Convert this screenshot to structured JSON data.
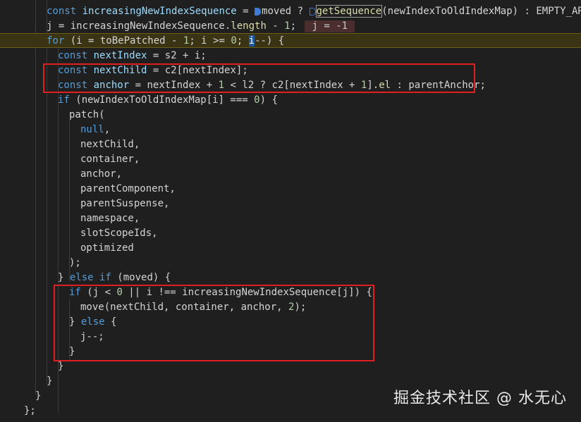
{
  "code": {
    "l01_a": "const",
    "l01_b": "increasingNewIndexSequence",
    "l01_c": " = ",
    "l01_d": "moved",
    "l01_e": " ? ",
    "l01_f": "getSequence",
    "l01_g": "(newIndexToOldIndexMap) : EMPTY_ARR;",
    "l02_a": "j = increasingNewIndexSequence.",
    "l02_b": "length",
    "l02_c": " - ",
    "l02_d": "1",
    "l02_e": ";",
    "l02_hint": "j = -1",
    "l03_a": "for",
    "l03_b": " (i = toBePatched - ",
    "l03_c": "1",
    "l03_d": "; i >= ",
    "l03_e": "0",
    "l03_f": "; ",
    "l03_g": "i",
    "l03_h": "--) {",
    "l04_a": "const",
    "l04_b": "nextIndex",
    "l04_c": " = s2 + i;",
    "l05_a": "const",
    "l05_b": "nextChild",
    "l05_c": " = c2[nextIndex];",
    "l06_a": "const",
    "l06_b": "anchor",
    "l06_c": " = nextIndex + ",
    "l06_d": "1",
    "l06_e": " < l2 ? c2[nextIndex + ",
    "l06_f": "1",
    "l06_g": "].",
    "l06_h": "el",
    "l06_i": " : parentAnchor;",
    "l07_a": "if",
    "l07_b": " (newIndexToOldIndexMap[i] === ",
    "l07_c": "0",
    "l07_d": ") {",
    "l08": "patch(",
    "l09": "null",
    "l10": "nextChild,",
    "l11": "container,",
    "l12": "anchor,",
    "l13": "parentComponent,",
    "l14": "parentSuspense,",
    "l15": "namespace,",
    "l16": "slotScopeIds,",
    "l17": "optimized",
    "l18": ");",
    "l19_a": "} ",
    "l19_b": "else if",
    "l19_c": " (moved) {",
    "l20_a": "if",
    "l20_b": " (j < ",
    "l20_c": "0",
    "l20_d": " || i !== increasingNewIndexSequence[j]) {",
    "l21_a": "move(nextChild, container, anchor, ",
    "l21_b": "2",
    "l21_c": ");",
    "l22_a": "} ",
    "l22_b": "else",
    "l22_c": " {",
    "l23": "j--;",
    "l24": "}",
    "l25": "}",
    "l26": "}",
    "l27": "}",
    "l28": "};"
  },
  "watermark": "掘金技术社区 @ 水无心"
}
